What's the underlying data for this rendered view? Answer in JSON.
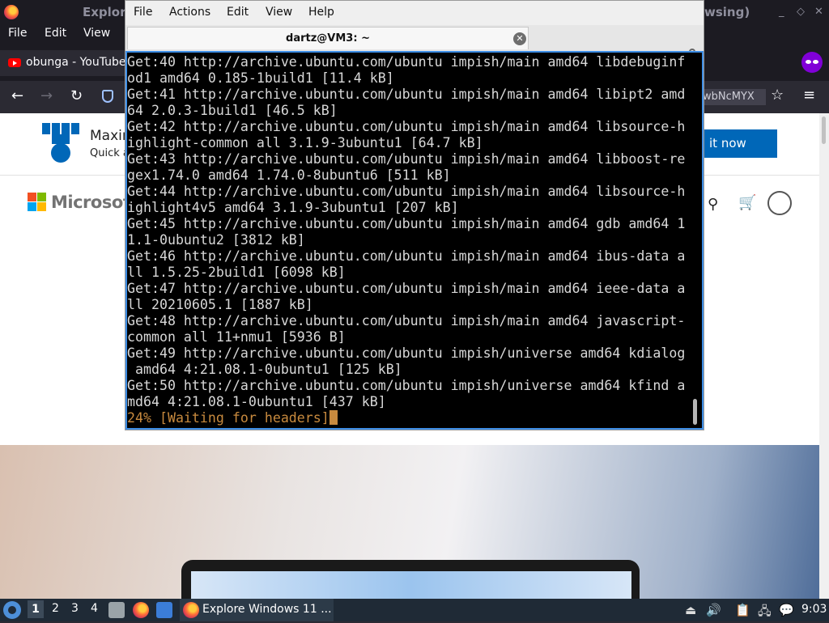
{
  "firefox": {
    "title_left": "Explor",
    "title_right": "wsing)",
    "menu": [
      "File",
      "Edit",
      "View"
    ],
    "tab_label": "obunga - YouTube",
    "url_tail": "wbNcMYX",
    "webpage": {
      "banner_title": "Maxin",
      "banner_subtitle": "Quick a",
      "banner_button": "it now",
      "brand_name": "Microsoft"
    }
  },
  "terminal": {
    "menu": [
      "File",
      "Actions",
      "Edit",
      "View",
      "Help"
    ],
    "tab_title": "dartz@VM3: ~",
    "close_glyph": "✕",
    "lines": [
      "Get:40 http://archive.ubuntu.com/ubuntu impish/main amd64 libdebuginf",
      "od1 amd64 0.185-1build1 [11.4 kB]",
      "Get:41 http://archive.ubuntu.com/ubuntu impish/main amd64 libipt2 amd",
      "64 2.0.3-1build1 [46.5 kB]",
      "Get:42 http://archive.ubuntu.com/ubuntu impish/main amd64 libsource-h",
      "ighlight-common all 3.1.9-3ubuntu1 [64.7 kB]",
      "Get:43 http://archive.ubuntu.com/ubuntu impish/main amd64 libboost-re",
      "gex1.74.0 amd64 1.74.0-8ubuntu6 [511 kB]",
      "Get:44 http://archive.ubuntu.com/ubuntu impish/main amd64 libsource-h",
      "ighlight4v5 amd64 3.1.9-3ubuntu1 [207 kB]",
      "Get:45 http://archive.ubuntu.com/ubuntu impish/main amd64 gdb amd64 1",
      "1.1-0ubuntu2 [3812 kB]",
      "Get:46 http://archive.ubuntu.com/ubuntu impish/main amd64 ibus-data a",
      "ll 1.5.25-2build1 [6098 kB]",
      "Get:47 http://archive.ubuntu.com/ubuntu impish/main amd64 ieee-data a",
      "ll 20210605.1 [1887 kB]",
      "Get:48 http://archive.ubuntu.com/ubuntu impish/main amd64 javascript-",
      "common all 11+nmu1 [5936 B]",
      "Get:49 http://archive.ubuntu.com/ubuntu impish/universe amd64 kdialog",
      " amd64 4:21.08.1-0ubuntu1 [125 kB]",
      "Get:50 http://archive.ubuntu.com/ubuntu impish/universe amd64 kfind a",
      "md64 4:21.08.1-0ubuntu1 [437 kB]"
    ],
    "status_line": "24% [Waiting for headers]"
  },
  "taskbar": {
    "workspaces": [
      "1",
      "2",
      "3",
      "4"
    ],
    "task_label": "Explore Windows 11 ...",
    "clock": "9:03"
  },
  "colors": {
    "terminal_bg": "#000000",
    "terminal_text": "#d8d8d8",
    "progress_text": "#c88a3e",
    "focus_border": "#3d8ee6",
    "taskbar_bg": "#1f2a36",
    "ms_blue": "#0067b8"
  },
  "icons": {
    "firefox": "firefox-icon",
    "youtube": "youtube-icon",
    "private_browsing": "private-browsing-icon",
    "tracking_protection": "shield-icon",
    "bookmark": "star-icon",
    "menu": "hamburger-icon",
    "search": "search-icon",
    "cart": "cart-icon",
    "account": "account-icon",
    "tab_close": "close-icon",
    "lock": "lock-icon",
    "start": "start-menu-icon",
    "volume": "volume-icon",
    "network": "network-icon"
  }
}
